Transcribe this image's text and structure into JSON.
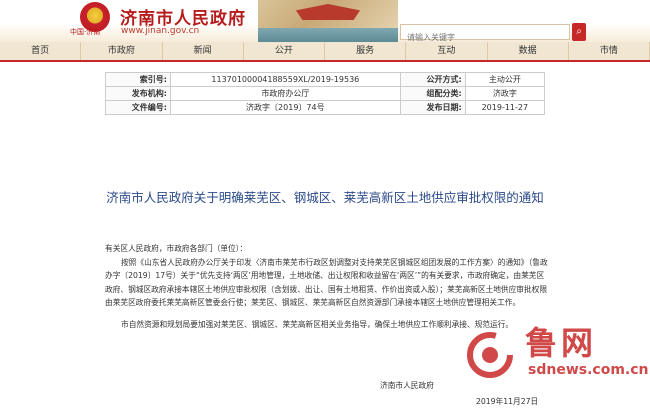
{
  "header": {
    "emblem_caption": "中国·济南",
    "site_title": "济南市人民政府",
    "site_url": "www.jinan.gov.cn",
    "search_placeholder": "请输入关键字",
    "search_icon": "search-icon"
  },
  "nav": {
    "items": [
      "首页",
      "市政府",
      "新闻",
      "公开",
      "服务",
      "互动",
      "数据",
      "市情"
    ]
  },
  "meta": {
    "rows": [
      {
        "label1": "索引号:",
        "value1": "11370100004188559XL/2019-19536",
        "label2": "公开方式:",
        "value2": "主动公开"
      },
      {
        "label1": "发布机构:",
        "value1": "市政府办公厅",
        "label2": "组配分类:",
        "value2": "济政字"
      },
      {
        "label1": "文件编号:",
        "value1": "济政字〔2019〕74号",
        "label2": "发布日期:",
        "value2": "2019-11-27"
      }
    ]
  },
  "doc": {
    "title": "济南市人民政府关于明确莱芜区、钢城区、莱芜高新区土地供应审批权限的通知",
    "salutation": "有关区人民政府，市政府各部门（单位）：",
    "para1": "按照《山东省人民政府办公厅关于印发〈济南市莱芜市行政区划调整对支持莱芜区钢城区组团发展的工作方案〉的通知》（鲁政办字〔2019〕17号）关于“优先支持‘两区’用地管理，土地收储、出让权限和收益留在‘两区’”的有关要求，市政府确定，由莱芜区政府、钢城区政府承接本辖区土地供应审批权限（含划拨、出让、国有土地租赁、作价出资或入股）；莱芜高新区土地供应审批权限由莱芜区政府委托莱芜高新区管委会行使；莱芜区、钢城区、莱芜高新区自然资源部门承接本辖区土地供应管理相关工作。",
    "para2": "市自然资源和规划局要加强对莱芜区、钢城区、莱芜高新区相关业务指导，确保土地供应工作顺利承接、规范运行。",
    "signature": "济南市人民政府",
    "date": "2019年11月27日"
  },
  "watermark": {
    "text": "鲁网",
    "url": "sdnews.com.cn"
  },
  "colors": {
    "brand_red": "#b71c1c",
    "nav_bg": "#f0e6d2",
    "title_blue": "#2b4a88"
  }
}
